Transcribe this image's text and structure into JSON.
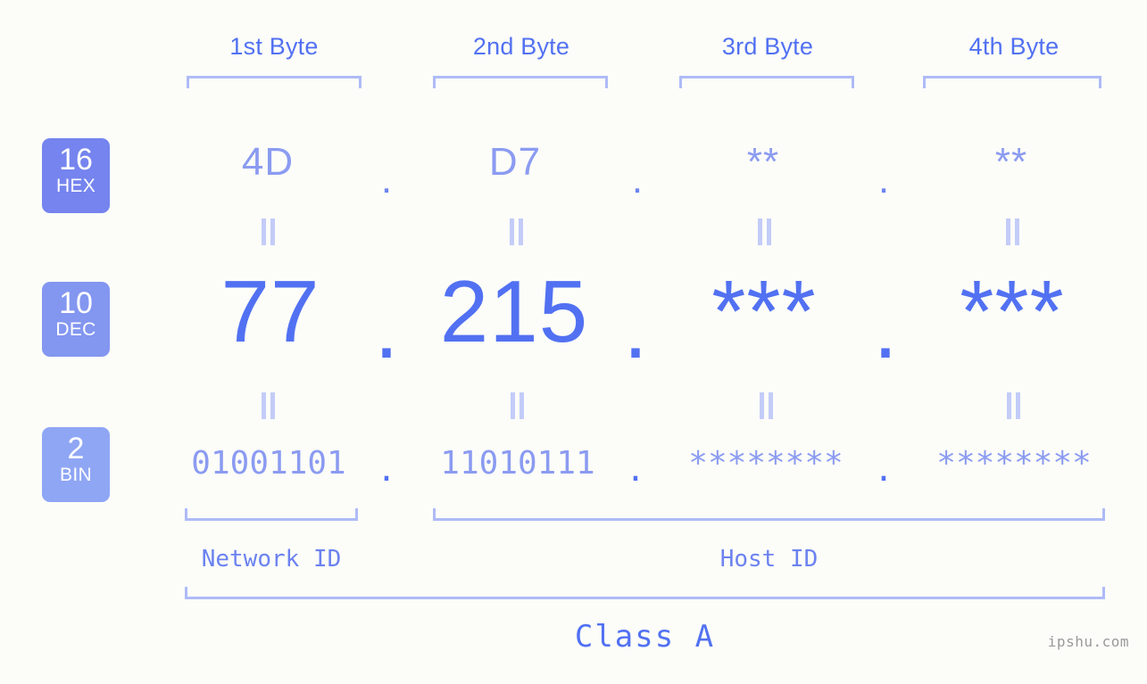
{
  "colors": {
    "background": "#fcfdf9",
    "accent_strong": "#5271f2",
    "accent_mid": "#8b9bf1",
    "accent_light": "#aebbf7",
    "connector": "#c3ccf8",
    "badge_hex": "#7584ee",
    "badge_dec": "#8396f0",
    "badge_bin": "#8fa6f4",
    "watermark": "#9a9a9a"
  },
  "byte_headers": [
    {
      "label": "1st Byte"
    },
    {
      "label": "2nd Byte"
    },
    {
      "label": "3rd Byte"
    },
    {
      "label": "4th Byte"
    }
  ],
  "bases": [
    {
      "number": "16",
      "name": "HEX"
    },
    {
      "number": "10",
      "name": "DEC"
    },
    {
      "number": "2",
      "name": "BIN"
    }
  ],
  "rows": {
    "hex": {
      "base_number": "16",
      "base_name": "HEX",
      "values": [
        "4D",
        "D7",
        "**",
        "**"
      ],
      "separators": [
        ".",
        ".",
        "."
      ]
    },
    "dec": {
      "base_number": "10",
      "base_name": "DEC",
      "values": [
        "77",
        "215",
        "***",
        "***"
      ],
      "separators": [
        ".",
        ".",
        "."
      ]
    },
    "bin": {
      "base_number": "2",
      "base_name": "BIN",
      "values": [
        "01001101",
        "11010111",
        "********",
        "********"
      ],
      "separators": [
        ".",
        ".",
        "."
      ]
    }
  },
  "connectors": {
    "glyph": "=",
    "rows": 2,
    "per_row": 4
  },
  "segments": {
    "network_id": "Network ID",
    "host_id": "Host ID",
    "class": "Class A"
  },
  "watermark": "ipshu.com"
}
